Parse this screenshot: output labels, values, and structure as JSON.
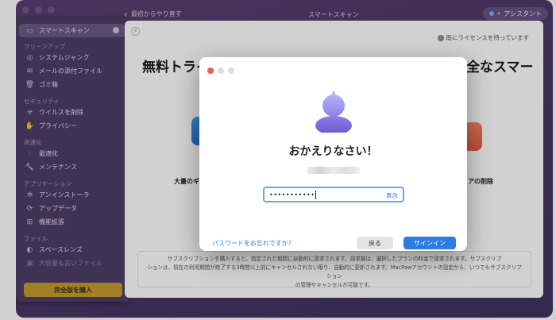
{
  "window": {
    "back_link": "最初からやり直す",
    "title": "スマートスキャン",
    "assistant_label": "アシスタント"
  },
  "sidebar": {
    "active_item": "スマートスキャン",
    "sections": [
      {
        "title": "クリーンアップ",
        "items": [
          "システムジャンク",
          "メールの添付ファイル",
          "ゴミ箱"
        ]
      },
      {
        "title": "セキュリティ",
        "items": [
          "ウイルスを削除",
          "プライバシー"
        ]
      },
      {
        "title": "高速化",
        "items": [
          "最適化",
          "メンテナンス"
        ]
      },
      {
        "title": "アプリケーション",
        "items": [
          "アンインストーラ",
          "アップデータ",
          "機能拡張"
        ]
      },
      {
        "title": "ファイル",
        "items": [
          "スペースレンズ",
          "大容量＆古いファイル"
        ]
      }
    ],
    "buy_button": "完全版を購入"
  },
  "panel": {
    "have_license": "既にライセンスを持っています",
    "headline_left": "無料トライ",
    "headline_right": "全なスマー",
    "feature_left": "大量のギ",
    "feature_right": "アの削除",
    "notice_line1": "サブスクリプションを購入すると、指定された期間に自動的に請求されます。請求額は、選択したプランの料金で請求されます。サブスクリプ",
    "notice_line2": "ションは、現在の利用期間が終了する3時間以上前にキャンセルされない限り、自動的に更新されます。MacPawアカウントの設定から、いつでもサブスクリプション",
    "notice_line3": "の管理やキャンセルが可能です。"
  },
  "login_modal": {
    "heading": "おかえりなさい！",
    "password_value": "•••••••••••",
    "show_label": "表示",
    "forgot_link": "パスワードをお忘れですか？",
    "back_button": "戻る",
    "signin_button": "サインイン",
    "accent": "#2d7be5"
  }
}
